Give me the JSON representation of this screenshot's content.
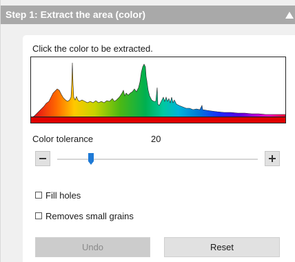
{
  "panel": {
    "title": "Step 1: Extract the area (color)",
    "collapse_icon": "triangle-up-icon"
  },
  "extract": {
    "instruction": "Click the color to be extracted."
  },
  "tolerance": {
    "label": "Color tolerance",
    "value": "20",
    "decrease_icon": "minus-icon",
    "increase_icon": "plus-icon"
  },
  "options": {
    "fill_holes_label": "Fill holes",
    "fill_holes_checked": false,
    "small_grains_label": "Removes small grains",
    "small_grains_checked": false
  },
  "actions": {
    "undo_label": "Undo",
    "undo_enabled": false,
    "reset_label": "Reset"
  },
  "colors": {
    "header_bg": "#a9a9a9",
    "accent": "#1e7ad6",
    "baseline": "#e00000"
  }
}
